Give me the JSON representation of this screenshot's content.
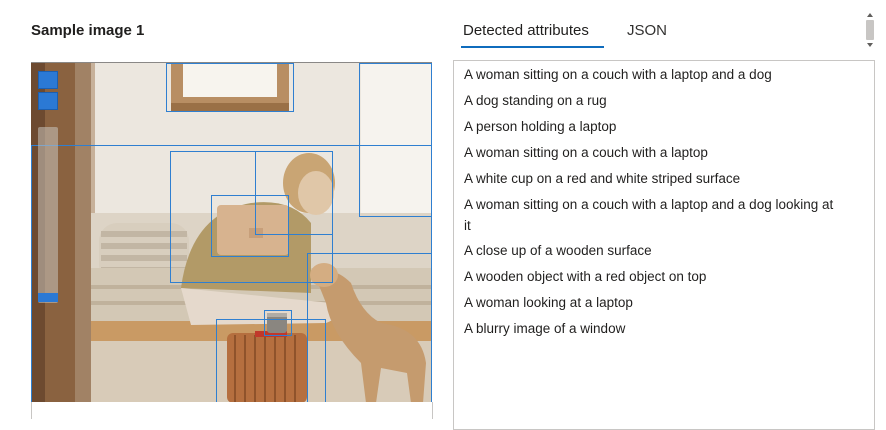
{
  "page": {
    "title": "Sample image 1"
  },
  "tabs": [
    {
      "label": "Detected attributes",
      "active": true
    },
    {
      "label": "JSON",
      "active": false
    }
  ],
  "results": [
    "A woman sitting on a couch with a laptop and a dog",
    "A dog standing on a rug",
    "A person holding a laptop",
    "A woman sitting on a couch with a laptop",
    "A white cup on a red and white striped surface",
    "A woman sitting on a couch with a laptop and a dog looking at",
    "it",
    "A close up of a wooden surface",
    "A wooden object with a red object on top",
    "A woman looking at a laptop",
    "A blurry image of a window"
  ],
  "colors": {
    "accent": "#0f6cbd",
    "bbox": "#2f7fd0"
  },
  "icons": {
    "zoom_in": "zoom-in-icon",
    "zoom_out": "zoom-out-icon"
  }
}
